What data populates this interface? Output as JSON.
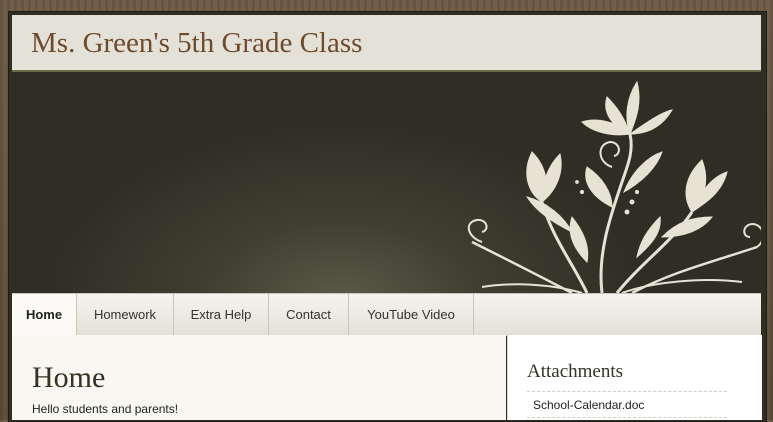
{
  "site": {
    "title": "Ms. Green's 5th Grade Class"
  },
  "nav": {
    "items": [
      {
        "label": "Home",
        "active": true
      },
      {
        "label": "Homework"
      },
      {
        "label": "Extra Help"
      },
      {
        "label": "Contact"
      },
      {
        "label": "YouTube Video"
      }
    ]
  },
  "main": {
    "title": "Home",
    "intro": "Hello students and parents!"
  },
  "sidebar": {
    "title": "Attachments",
    "attachments": [
      "School-Calendar.doc"
    ]
  },
  "colors": {
    "title": "#6e4b2d",
    "banner": "#2f2e24",
    "floral": "#e6e2d4"
  },
  "banner": {
    "icon": "floral-ornament-icon"
  }
}
